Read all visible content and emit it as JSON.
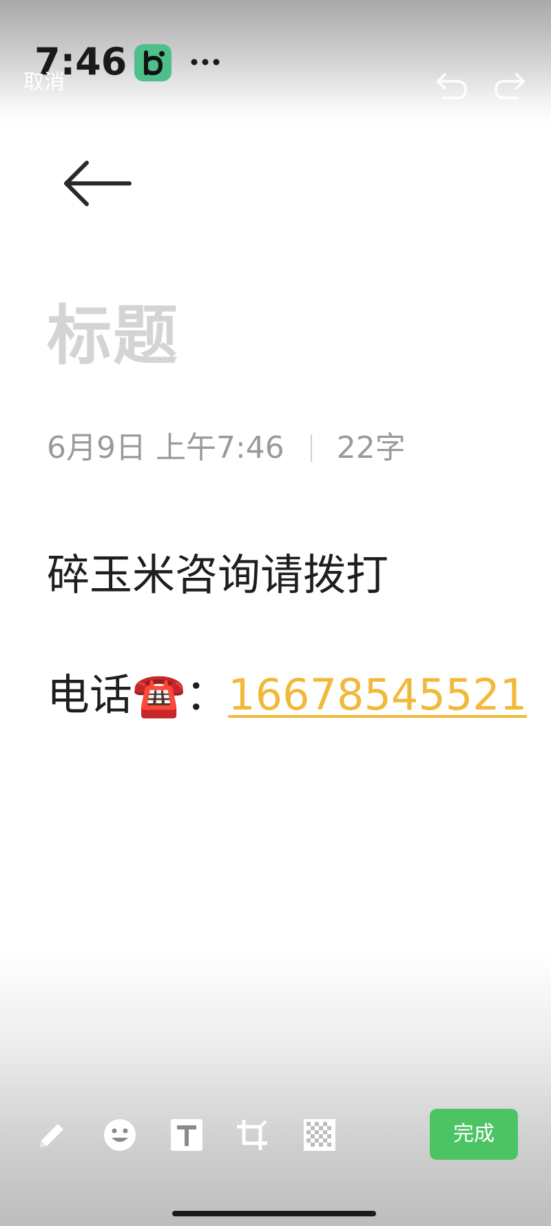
{
  "status_bar": {
    "time": "7:46",
    "app_badge_icon": "b-app-icon",
    "more_icon": "more-dots-icon"
  },
  "editor_top": {
    "cancel_label": "取消",
    "undo_icon": "undo-icon",
    "redo_icon": "redo-icon"
  },
  "note": {
    "back_icon": "back-arrow-icon",
    "title_placeholder": "标题",
    "date": "6月9日 上午7:46",
    "char_count": "22字",
    "line1": "碎玉米咨询请拨打",
    "line2_prefix": "电话",
    "line2_emoji": "☎️",
    "line2_colon": "：",
    "phone_number": "16678545521"
  },
  "toolbar": {
    "tools": [
      "pen-icon",
      "emoji-icon",
      "text-icon",
      "crop-icon",
      "mosaic-icon"
    ],
    "done_label": "完成"
  },
  "colors": {
    "accent_green": "#4cc463",
    "link_yellow": "#f0b93a",
    "badge_green": "#4fbf8a",
    "title_placeholder_gray": "#d4d4d4"
  }
}
